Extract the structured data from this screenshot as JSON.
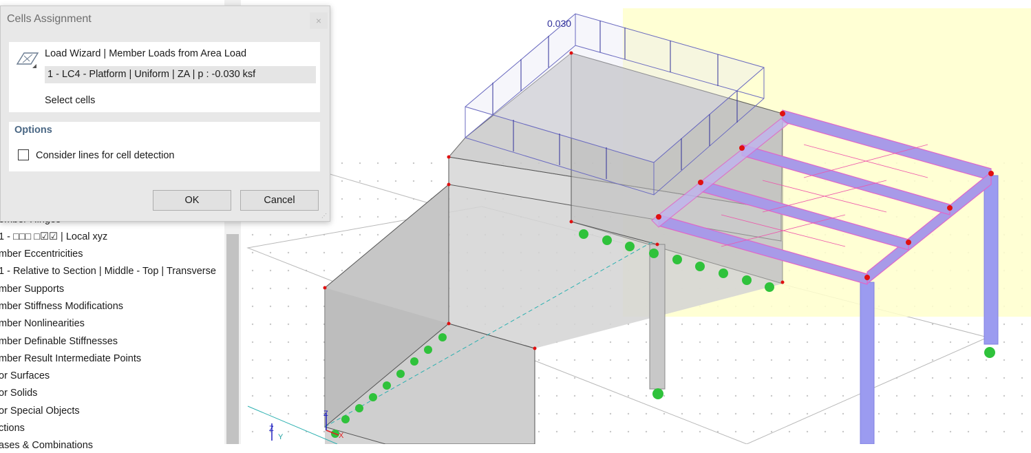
{
  "dialog": {
    "title": "Cells Assignment",
    "close_glyph": "×",
    "wizard_title": "Load Wizard | Member Loads from Area Load",
    "load_item": "1 - LC4 - Platform | Uniform | ZA | p : -0.030 ksf",
    "select_cells": "Select cells",
    "options_title": "Options",
    "consider_lines_label": "Consider lines for cell detection",
    "consider_lines_checked": false,
    "ok_label": "OK",
    "cancel_label": "Cancel"
  },
  "tree": {
    "items": [
      "ember Hinges",
      "1 - □□□  □☑☑ | Local xyz",
      "mber Eccentricities",
      "1 - Relative to Section | Middle - Top | Transverse",
      "mber Supports",
      "mber Stiffness Modifications",
      "mber Nonlinearities",
      "mber Definable Stiffnesses",
      "mber Result Intermediate Points",
      "or Surfaces",
      "or Solids",
      "or Special Objects",
      "ctions",
      "ases & Combinations"
    ]
  },
  "viewport": {
    "load_value_label": "0.030",
    "axis_labels": {
      "z": "Z",
      "y": "Y",
      "x": "X"
    },
    "colors": {
      "load_outline": "#6b6bc0",
      "member": "#9e8fe6",
      "member_edge": "#e066c8",
      "support": "#2fc23b",
      "node": "#e01010",
      "highlight": "#ffffcc"
    }
  }
}
